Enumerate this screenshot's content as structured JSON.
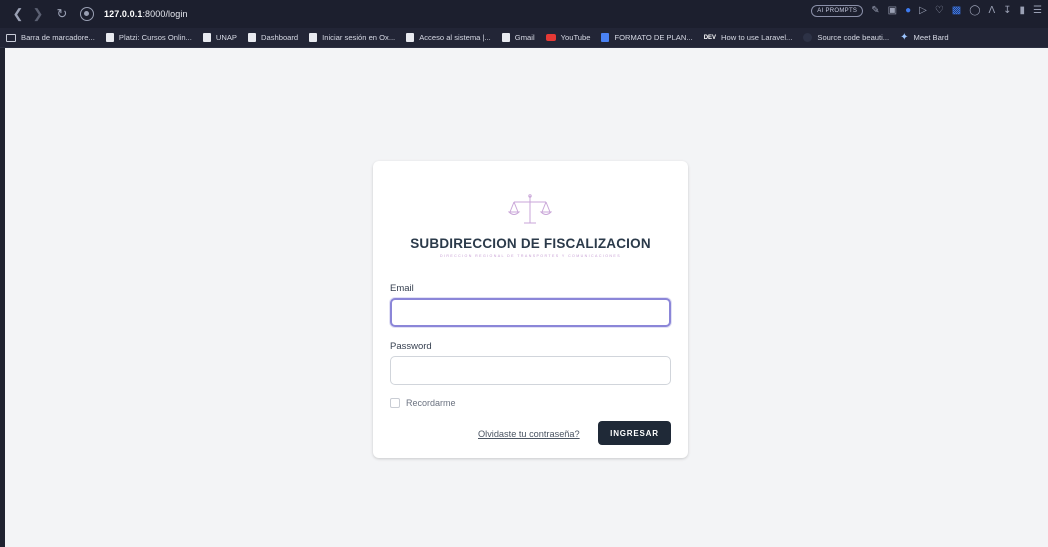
{
  "browser": {
    "url_host": "127.0.0.1",
    "url_rest": ":8000/login",
    "ai_prompts_label": "AI PROMPTS"
  },
  "bookmarks": [
    {
      "label": "Barra de marcadore...",
      "icon": "folder-icon"
    },
    {
      "label": "Platzi: Cursos Onlin...",
      "icon": "page-icon"
    },
    {
      "label": "UNAP",
      "icon": "page-icon"
    },
    {
      "label": "Dashboard",
      "icon": "page-icon"
    },
    {
      "label": "Iniciar sesión en Ox...",
      "icon": "page-icon"
    },
    {
      "label": "Acceso al sistema |...",
      "icon": "page-icon"
    },
    {
      "label": "Gmail",
      "icon": "page-icon"
    },
    {
      "label": "YouTube",
      "icon": "youtube-icon"
    },
    {
      "label": "FORMATO DE PLAN...",
      "icon": "docs-icon"
    },
    {
      "label": "How to use Laravel...",
      "icon": "dev-icon"
    },
    {
      "label": "Source code beauti...",
      "icon": "circle-icon"
    },
    {
      "label": "Meet Bard",
      "icon": "sparkle-icon"
    }
  ],
  "login": {
    "title": "SUBDIRECCION DE FISCALIZACION",
    "subtitle": "DIRECCION REGIONAL DE TRANSPORTES Y COMUNICACIONES",
    "email_label": "Email",
    "email_value": "",
    "password_label": "Password",
    "password_value": "",
    "remember_label": "Recordarme",
    "forgot_label": "Olvidaste tu contraseña?",
    "submit_label": "INGRESAR"
  },
  "colors": {
    "button": "#1f2937",
    "focus_ring": "#8b86d8",
    "logo": "#c9a6d8"
  }
}
